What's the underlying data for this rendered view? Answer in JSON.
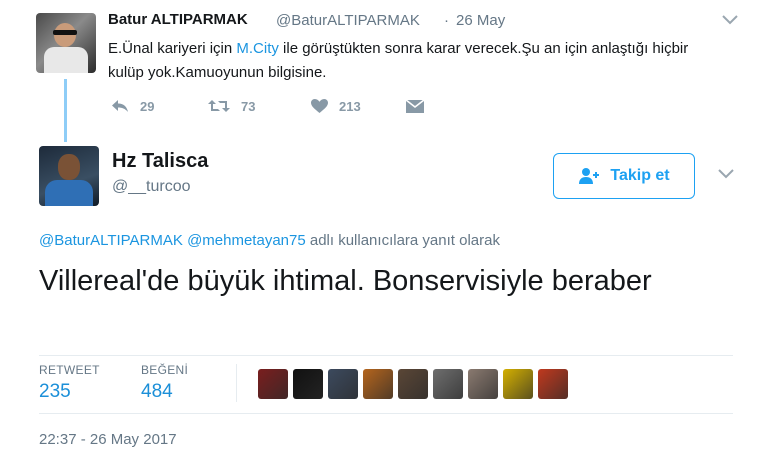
{
  "parent_tweet": {
    "author_name": "Batur ALTIPARMAK",
    "author_handle": "@BaturALTIPARMAK",
    "separator": "·",
    "date": "26 May",
    "text_before_link": "E.Ünal kariyeri için ",
    "link": "M.City",
    "text_after_link": " ile görüştükten sonra karar verecek.Şu an için anlaştığı hiçbir kulüp yok.Kamuoyunun bilgisine.",
    "actions": {
      "reply_count": "29",
      "retweet_count": "73",
      "like_count": "213"
    },
    "icons": [
      "reply-icon",
      "retweet-icon",
      "heart-icon",
      "direct-message-icon",
      "chevron-down-icon"
    ]
  },
  "main_tweet": {
    "author_name": "Hz Talisca",
    "author_handle": "@__turcoo",
    "follow_label": "Takip et",
    "reply_handle_1": "@BaturALTIPARMAK",
    "reply_handle_2": "@mehmetayan75",
    "reply_suffix": "adlı kullanıcılara yanıt olarak",
    "text": "Villereal'de büyük ihtimal. Bonservisiyle beraber",
    "retweets_label": "RETWEET",
    "retweets_value": "235",
    "likes_label": "BEĞENİ",
    "likes_value": "484",
    "timestamp": "22:37 - 26 May 2017",
    "liker_avatar_colors": [
      "#7a1e1e",
      "#111111",
      "#3c4a5e",
      "#b5651d",
      "#5a4636",
      "#6e6e6e",
      "#8a7a70",
      "#d4b000",
      "#c0391e"
    ]
  },
  "colors": {
    "link": "#1b95e0",
    "muted": "#657786",
    "follow_border": "#1da1f2",
    "thread_line": "#8ecdf7"
  }
}
